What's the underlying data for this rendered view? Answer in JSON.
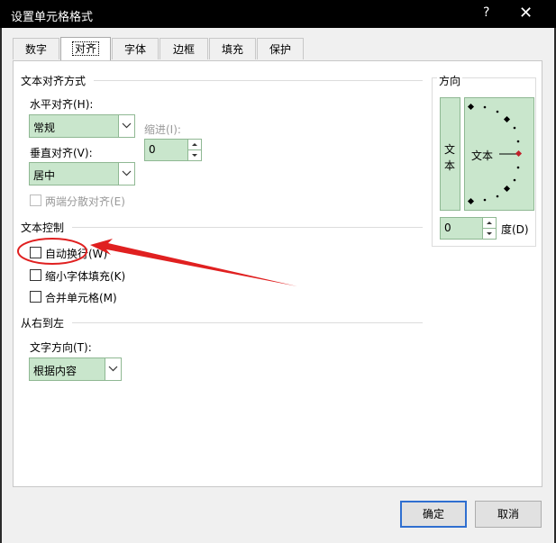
{
  "window": {
    "title": "设置单元格格式",
    "help": "?",
    "close": "✕"
  },
  "tabs": [
    {
      "label": "数字"
    },
    {
      "label": "对齐"
    },
    {
      "label": "字体"
    },
    {
      "label": "边框"
    },
    {
      "label": "填充"
    },
    {
      "label": "保护"
    }
  ],
  "text_alignment": {
    "section_title": "文本对齐方式",
    "horizontal": {
      "label": "水平对齐(H):",
      "value": "常规"
    },
    "indent": {
      "label": "缩进(I):",
      "value": "0"
    },
    "vertical": {
      "label": "垂直对齐(V):",
      "value": "居中"
    },
    "justify_distributed": {
      "label": "两端分散对齐(E)"
    }
  },
  "text_control": {
    "section_title": "文本控制",
    "wrap": {
      "label": "自动换行(W)",
      "checked": false
    },
    "shrink": {
      "label": "缩小字体填充(K)",
      "checked": false
    },
    "merge": {
      "label": "合并单元格(M)",
      "checked": false
    }
  },
  "rtl": {
    "section_title": "从右到左",
    "direction": {
      "label": "文字方向(T):",
      "value": "根据内容"
    }
  },
  "orientation": {
    "section_title": "方向",
    "vertical_text": [
      "文",
      "本"
    ],
    "dial_text": "文本",
    "degrees": {
      "value": "0",
      "label": "度(D)"
    }
  },
  "buttons": {
    "ok": "确定",
    "cancel": "取消"
  },
  "colors": {
    "field_bg": "#c9e6cc",
    "annotation": "#e02020",
    "accent": "#2f6fd0"
  }
}
